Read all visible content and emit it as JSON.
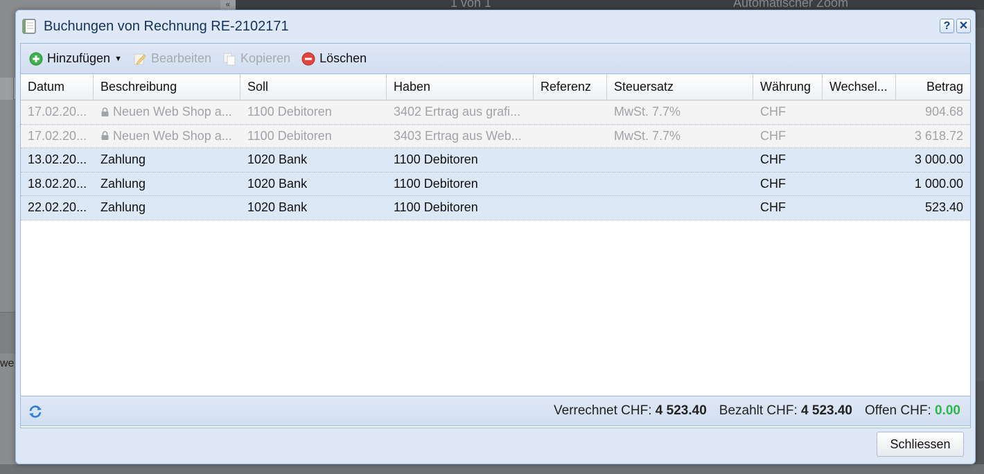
{
  "background": {
    "partial_text": "we",
    "page_indicator": "1   von 1",
    "zoom_label": "Automatischer Zoom",
    "collapse_glyph": "«"
  },
  "dialog": {
    "title": "Buchungen von Rechnung RE-2102171",
    "help_label": "?",
    "close_label": "✕"
  },
  "toolbar": {
    "add_label": "Hinzufügen",
    "edit_label": "Bearbeiten",
    "copy_label": "Kopieren",
    "delete_label": "Löschen"
  },
  "grid": {
    "columns": [
      "Datum",
      "Beschreibung",
      "Soll",
      "Haben",
      "Referenz",
      "Steuersatz",
      "Währung",
      "Wechsel...",
      "Betrag"
    ],
    "rows": [
      {
        "datum": "17.02.20...",
        "beschreibung": "Neuen Web Shop a...",
        "soll": "1100 Debitoren",
        "haben": "3402 Ertrag aus grafi...",
        "referenz": "",
        "steuersatz": "MwSt. 7.7%",
        "waehrung": "CHF",
        "wechsel": "",
        "betrag": "904.68",
        "locked": true
      },
      {
        "datum": "17.02.20...",
        "beschreibung": "Neuen Web Shop a...",
        "soll": "1100 Debitoren",
        "haben": "3403 Ertrag aus Web...",
        "referenz": "",
        "steuersatz": "MwSt. 7.7%",
        "waehrung": "CHF",
        "wechsel": "",
        "betrag": "3 618.72",
        "locked": true
      },
      {
        "datum": "13.02.20...",
        "beschreibung": "Zahlung",
        "soll": "1020 Bank",
        "haben": "1100 Debitoren",
        "referenz": "",
        "steuersatz": "",
        "waehrung": "CHF",
        "wechsel": "",
        "betrag": "3 000.00",
        "locked": false
      },
      {
        "datum": "18.02.20...",
        "beschreibung": "Zahlung",
        "soll": "1020 Bank",
        "haben": "1100 Debitoren",
        "referenz": "",
        "steuersatz": "",
        "waehrung": "CHF",
        "wechsel": "",
        "betrag": "1 000.00",
        "locked": false
      },
      {
        "datum": "22.02.20...",
        "beschreibung": "Zahlung",
        "soll": "1020 Bank",
        "haben": "1100 Debitoren",
        "referenz": "",
        "steuersatz": "",
        "waehrung": "CHF",
        "wechsel": "",
        "betrag": "523.40",
        "locked": false
      }
    ]
  },
  "summary": {
    "verrechnet_label": "Verrechnet CHF:",
    "verrechnet_value": "4 523.40",
    "bezahlt_label": "Bezahlt CHF:",
    "bezahlt_value": "4 523.40",
    "offen_label": "Offen CHF:",
    "offen_value": "0.00"
  },
  "footer": {
    "close_button": "Schliessen"
  },
  "colors": {
    "accent": "#99bbe8",
    "offen_green": "#2fb54a",
    "delete_red": "#e0463c",
    "add_green": "#3cb44b"
  }
}
